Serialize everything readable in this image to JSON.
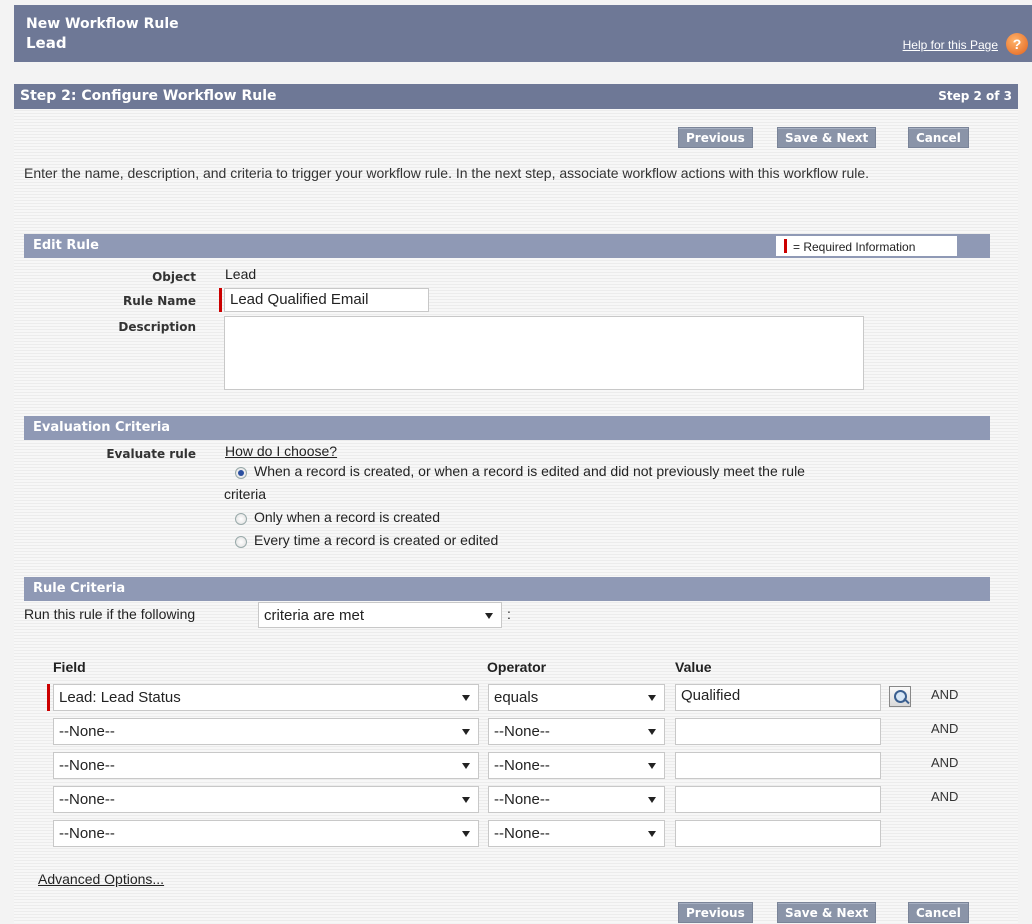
{
  "header": {
    "title": "New Workflow Rule",
    "subtitle": "Lead",
    "help_link": "Help for this Page",
    "help_icon": "?"
  },
  "step": {
    "title": "Step 2: Configure Workflow Rule",
    "count": "Step 2 of 3"
  },
  "buttons": {
    "previous": "Previous",
    "save_next": "Save & Next",
    "cancel": "Cancel"
  },
  "intro": "Enter the name, description, and criteria to trigger your workflow rule. In the next step, associate workflow actions with this workflow rule.",
  "edit_rule": {
    "section_title": "Edit Rule",
    "required_info": "= Required Information",
    "object_label": "Object",
    "object_value": "Lead",
    "rule_name_label": "Rule Name",
    "rule_name_value": "Lead Qualified Email",
    "description_label": "Description",
    "description_value": ""
  },
  "evaluation": {
    "section_title": "Evaluation Criteria",
    "label": "Evaluate rule",
    "help_link": "How do I choose?",
    "options": [
      {
        "text_line1": "When a record is created, or when a record is edited and did not previously meet the rule",
        "text_line2": "criteria",
        "selected": true
      },
      {
        "text_line1": "Only when a record is created",
        "selected": false
      },
      {
        "text_line1": "Every time a record is created or edited",
        "selected": false
      }
    ]
  },
  "rule_criteria": {
    "section_title": "Rule Criteria",
    "run_label": "Run this rule if the following",
    "run_select": "criteria are met",
    "colon": ":",
    "headers": {
      "field": "Field",
      "operator": "Operator",
      "value": "Value"
    },
    "rows": [
      {
        "field": "Lead: Lead Status",
        "operator": "equals",
        "value": "Qualified",
        "connector": "AND"
      },
      {
        "field": "--None--",
        "operator": "--None--",
        "value": "",
        "connector": "AND"
      },
      {
        "field": "--None--",
        "operator": "--None--",
        "value": "",
        "connector": "AND"
      },
      {
        "field": "--None--",
        "operator": "--None--",
        "value": "",
        "connector": "AND"
      },
      {
        "field": "--None--",
        "operator": "--None--",
        "value": "",
        "connector": ""
      }
    ],
    "advanced_link": "Advanced Options..."
  }
}
